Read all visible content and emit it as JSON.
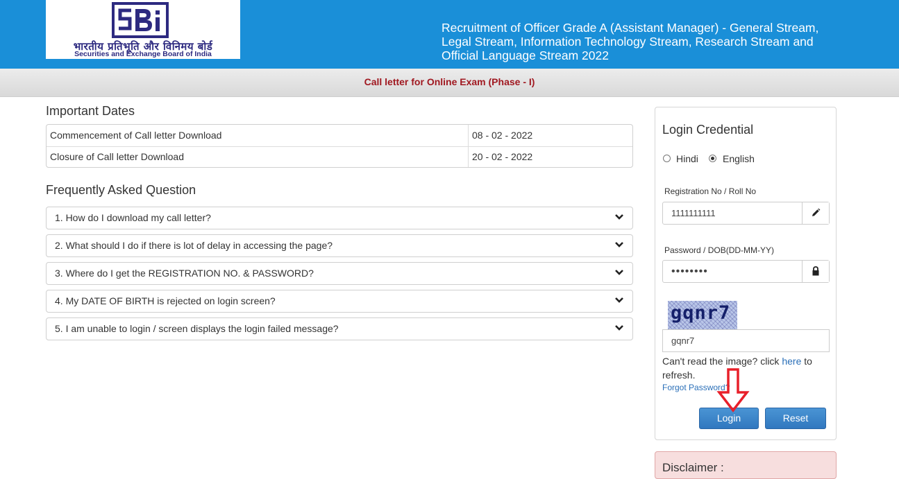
{
  "header": {
    "logo_hindi": "भारतीय प्रतिभूति और विनिमय बोर्ड",
    "logo_english": "Securities and Exchange Board of India",
    "title": "Recruitment of Officer Grade A (Assistant Manager) - General Stream, Legal Stream, Information Technology Stream, Research Stream and Official Language Stream 2022"
  },
  "subbar": {
    "text": "Call letter for Online Exam (Phase - I)"
  },
  "important_dates": {
    "title": "Important Dates",
    "rows": [
      {
        "label": "Commencement of Call letter Download",
        "date": "08 - 02 - 2022"
      },
      {
        "label": "Closure of Call letter Download",
        "date": "20 - 02 - 2022"
      }
    ]
  },
  "faq": {
    "title": "Frequently Asked Question",
    "items": [
      "1. How do I download my call letter?",
      "2. What should I do if there is lot of delay in accessing the page?",
      "3. Where do I get the REGISTRATION NO. & PASSWORD?",
      "4. My DATE OF BIRTH is rejected on login screen?",
      "5. I am unable to login / screen displays the login failed message?"
    ]
  },
  "login": {
    "title": "Login Credential",
    "languages": [
      {
        "label": "Hindi",
        "checked": false
      },
      {
        "label": "English",
        "checked": true
      }
    ],
    "registration_label": "Registration No / Roll No",
    "registration_value": "1111111111",
    "password_label": "Password / DOB(DD-MM-YY)",
    "password_value": "••••••••",
    "captcha_image_text": "gqnr7",
    "captcha_value": "gqnr7",
    "refresh_prefix": "Can't read the image? click ",
    "refresh_link": "here",
    "refresh_suffix": " to refresh.",
    "forgot_password": "Forgot Password?",
    "login_button": "Login",
    "reset_button": "Reset"
  },
  "disclaimer": {
    "title": "Disclaimer :"
  },
  "colors": {
    "header_blue": "#1a8fd8",
    "subbar_text": "#a01820",
    "button_blue": "#3178bf",
    "annotation_arrow": "#e8202a"
  }
}
